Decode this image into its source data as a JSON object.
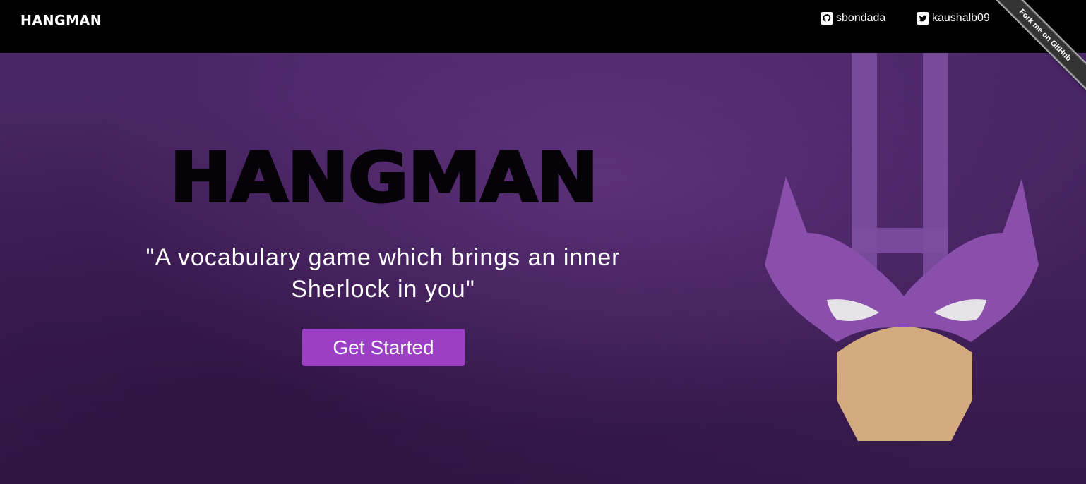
{
  "navbar": {
    "brand": "HANGMAN",
    "links": [
      {
        "label": "sbondada",
        "icon": "github-icon"
      },
      {
        "label": "kaushalb09",
        "icon": "twitter-icon"
      }
    ],
    "ribbon": "Fork me on GitHub"
  },
  "hero": {
    "title": "HANGMAN",
    "tagline": "\"A vocabulary game which brings an inner Sherlock in you\"",
    "cta_label": "Get Started",
    "illustration": "hawkeye-mask-illustration"
  },
  "colors": {
    "navbar_bg": "#000000",
    "hero_bg": "#42205c",
    "accent": "#9b3fc4",
    "mask_purple": "#8a4eab",
    "skin": "#d4ab7e"
  }
}
